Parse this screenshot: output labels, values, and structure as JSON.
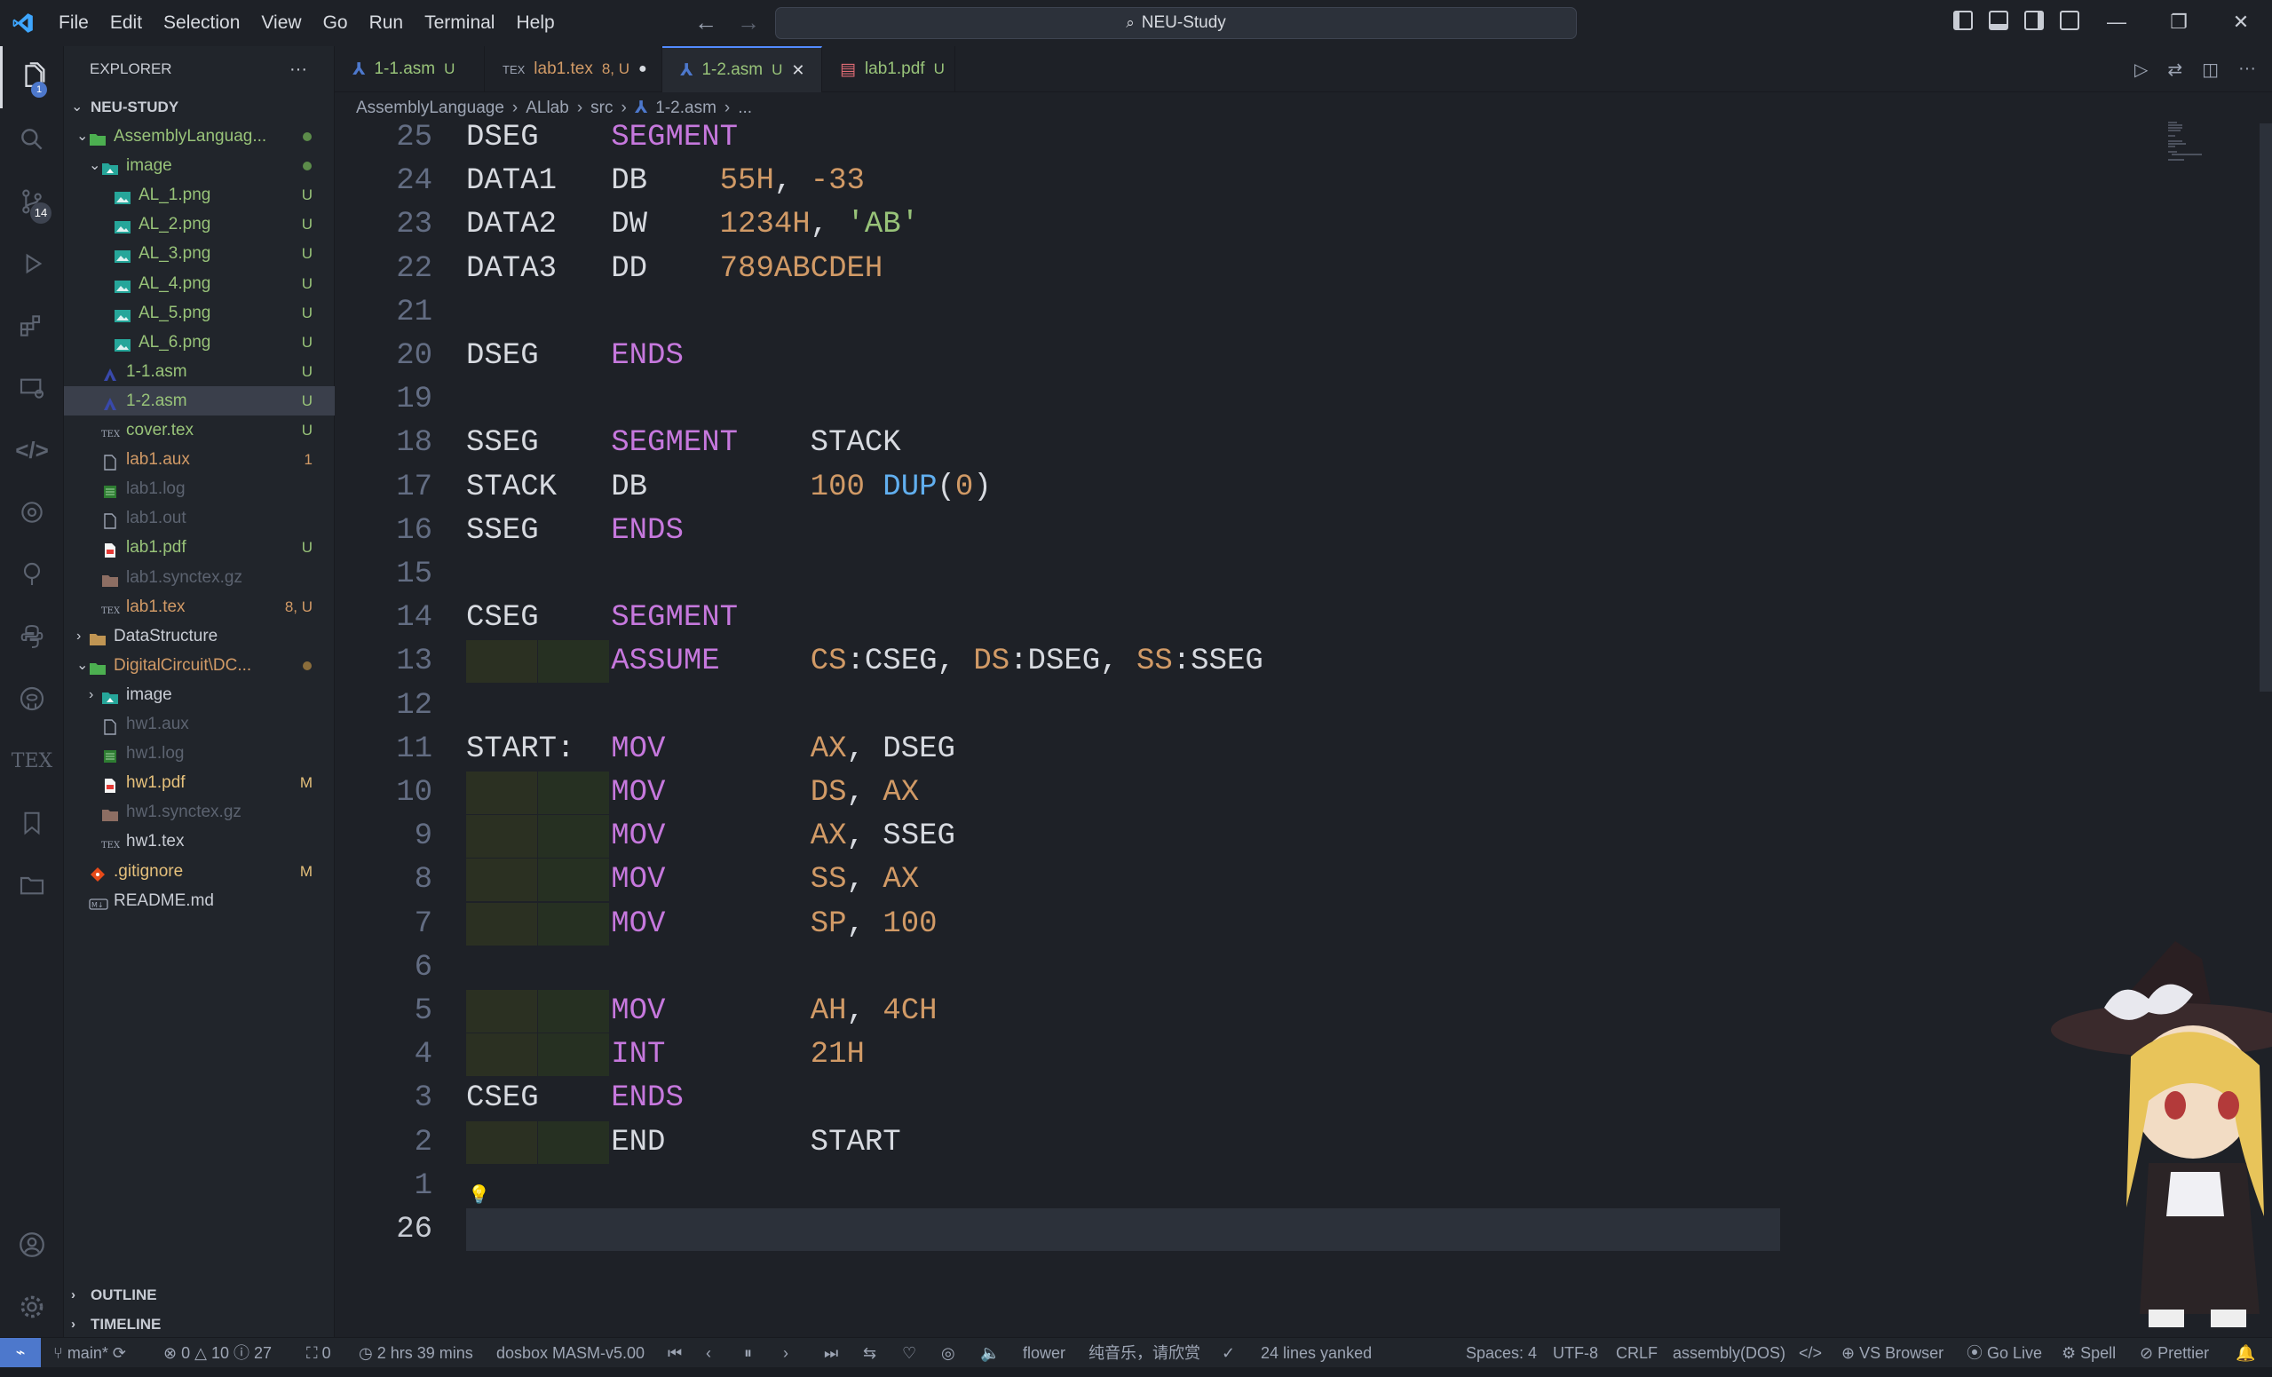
{
  "titlebar": {
    "menu": [
      "File",
      "Edit",
      "Selection",
      "View",
      "Go",
      "Run",
      "Terminal",
      "Help"
    ],
    "search_text": "NEU-Study"
  },
  "activity": {
    "explorer_badge": "1",
    "scm_badge": "14"
  },
  "sidebar": {
    "title": "EXPLORER",
    "more": "···",
    "root": "NEU-STUDY",
    "items": [
      {
        "label": "AssemblyLanguag...",
        "status": "",
        "color": "#98c379"
      },
      {
        "label": "image",
        "status": "",
        "color": "#98c379"
      },
      {
        "label": "AL_1.png",
        "status": "U",
        "color": "#98c379"
      },
      {
        "label": "AL_2.png",
        "status": "U",
        "color": "#98c379"
      },
      {
        "label": "AL_3.png",
        "status": "U",
        "color": "#98c379"
      },
      {
        "label": "AL_4.png",
        "status": "U",
        "color": "#98c379"
      },
      {
        "label": "AL_5.png",
        "status": "U",
        "color": "#98c379"
      },
      {
        "label": "AL_6.png",
        "status": "U",
        "color": "#98c379"
      },
      {
        "label": "1-1.asm",
        "status": "U",
        "color": "#98c379"
      },
      {
        "label": "1-2.asm",
        "status": "U",
        "color": "#98c379"
      },
      {
        "label": "cover.tex",
        "status": "U",
        "color": "#98c379"
      },
      {
        "label": "lab1.aux",
        "status": "1",
        "color": "#d19a66"
      },
      {
        "label": "lab1.log",
        "status": "",
        "color": "#5c6370"
      },
      {
        "label": "lab1.out",
        "status": "",
        "color": "#5c6370"
      },
      {
        "label": "lab1.pdf",
        "status": "U",
        "color": "#98c379"
      },
      {
        "label": "lab1.synctex.gz",
        "status": "",
        "color": "#5c6370"
      },
      {
        "label": "lab1.tex",
        "status": "8, U",
        "color": "#d19a66"
      },
      {
        "label": "DataStructure",
        "status": "",
        "color": "#c8ccd4"
      },
      {
        "label": "DigitalCircuit\\DC...",
        "status": "",
        "color": "#d19a66"
      },
      {
        "label": "image",
        "status": "",
        "color": "#c8ccd4"
      },
      {
        "label": "hw1.aux",
        "status": "",
        "color": "#5c6370"
      },
      {
        "label": "hw1.log",
        "status": "",
        "color": "#5c6370"
      },
      {
        "label": "hw1.pdf",
        "status": "M",
        "color": "#e5c07b"
      },
      {
        "label": "hw1.synctex.gz",
        "status": "",
        "color": "#5c6370"
      },
      {
        "label": "hw1.tex",
        "status": "",
        "color": "#c8ccd4"
      },
      {
        "label": ".gitignore",
        "status": "M",
        "color": "#e5c07b"
      },
      {
        "label": "README.md",
        "status": "",
        "color": "#c8ccd4"
      }
    ],
    "outline": "OUTLINE",
    "timeline": "TIMELINE"
  },
  "tabs": [
    {
      "label": "1-1.asm",
      "status": "U",
      "color": "#98c379"
    },
    {
      "label": "lab1.tex",
      "status": "8, U",
      "color": "#d19a66"
    },
    {
      "label": "1-2.asm",
      "status": "U",
      "color": "#98c379"
    },
    {
      "label": "lab1.pdf",
      "status": "U",
      "color": "#98c379"
    }
  ],
  "breadcrumb": [
    "AssemblyLanguage",
    "ALlab",
    "src",
    "1-2.asm",
    "..."
  ],
  "editor": {
    "lines": [
      {
        "num": "25",
        "t": [
          [
            "DSEG    ",
            "txt"
          ],
          [
            "SEGMENT",
            "kw"
          ]
        ]
      },
      {
        "num": "24",
        "t": [
          [
            "DATA1   ",
            "txt"
          ],
          [
            "DB    ",
            "txt"
          ],
          [
            "55H",
            "num"
          ],
          [
            ", ",
            "txt"
          ],
          [
            "-33",
            "num"
          ]
        ]
      },
      {
        "num": "23",
        "t": [
          [
            "DATA2   ",
            "txt"
          ],
          [
            "DW    ",
            "txt"
          ],
          [
            "1234H",
            "num"
          ],
          [
            ", ",
            "txt"
          ],
          [
            "'AB'",
            "str"
          ]
        ]
      },
      {
        "num": "22",
        "t": [
          [
            "DATA3   ",
            "txt"
          ],
          [
            "DD    ",
            "txt"
          ],
          [
            "789ABCDEH",
            "num"
          ]
        ]
      },
      {
        "num": "21",
        "t": []
      },
      {
        "num": "20",
        "t": [
          [
            "DSEG    ",
            "txt"
          ],
          [
            "ENDS",
            "kw"
          ]
        ]
      },
      {
        "num": "19",
        "t": []
      },
      {
        "num": "18",
        "t": [
          [
            "SSEG    ",
            "txt"
          ],
          [
            "SEGMENT",
            "kw"
          ],
          [
            "    STACK",
            "txt"
          ]
        ]
      },
      {
        "num": "17",
        "t": [
          [
            "STACK   ",
            "txt"
          ],
          [
            "DB         ",
            "txt"
          ],
          [
            "100 ",
            "num"
          ],
          [
            "DUP",
            "fn"
          ],
          [
            "(",
            "txt"
          ],
          [
            "0",
            "num"
          ],
          [
            ")",
            "txt"
          ]
        ]
      },
      {
        "num": "16",
        "t": [
          [
            "SSEG    ",
            "txt"
          ],
          [
            "ENDS",
            "kw"
          ]
        ]
      },
      {
        "num": "15",
        "t": []
      },
      {
        "num": "14",
        "t": [
          [
            "CSEG    ",
            "txt"
          ],
          [
            "SEGMENT",
            "kw"
          ]
        ]
      },
      {
        "num": "13",
        "t": [
          [
            "        ",
            "txt"
          ],
          [
            "ASSUME",
            "kw"
          ],
          [
            "     ",
            "txt"
          ],
          [
            "CS",
            "num"
          ],
          [
            ":CSEG, ",
            "txt"
          ],
          [
            "DS",
            "num"
          ],
          [
            ":DSEG, ",
            "txt"
          ],
          [
            "SS",
            "num"
          ],
          [
            ":SSEG",
            "txt"
          ]
        ]
      },
      {
        "num": "12",
        "t": []
      },
      {
        "num": "11",
        "t": [
          [
            "START:  ",
            "txt"
          ],
          [
            "MOV",
            "kw"
          ],
          [
            "        ",
            "txt"
          ],
          [
            "AX",
            "num"
          ],
          [
            ", DSEG",
            "txt"
          ]
        ]
      },
      {
        "num": "10",
        "t": [
          [
            "        ",
            "txt"
          ],
          [
            "MOV",
            "kw"
          ],
          [
            "        ",
            "txt"
          ],
          [
            "DS",
            "num"
          ],
          [
            ", ",
            "txt"
          ],
          [
            "AX",
            "num"
          ]
        ]
      },
      {
        "num": "9",
        "t": [
          [
            "        ",
            "txt"
          ],
          [
            "MOV",
            "kw"
          ],
          [
            "        ",
            "txt"
          ],
          [
            "AX",
            "num"
          ],
          [
            ", SSEG",
            "txt"
          ]
        ]
      },
      {
        "num": "8",
        "t": [
          [
            "        ",
            "txt"
          ],
          [
            "MOV",
            "kw"
          ],
          [
            "        ",
            "txt"
          ],
          [
            "SS",
            "num"
          ],
          [
            ", ",
            "txt"
          ],
          [
            "AX",
            "num"
          ]
        ]
      },
      {
        "num": "7",
        "t": [
          [
            "        ",
            "txt"
          ],
          [
            "MOV",
            "kw"
          ],
          [
            "        ",
            "txt"
          ],
          [
            "SP",
            "num"
          ],
          [
            ", ",
            "txt"
          ],
          [
            "100",
            "num"
          ]
        ]
      },
      {
        "num": "6",
        "t": []
      },
      {
        "num": "5",
        "t": [
          [
            "        ",
            "txt"
          ],
          [
            "MOV",
            "kw"
          ],
          [
            "        ",
            "txt"
          ],
          [
            "AH",
            "num"
          ],
          [
            ", ",
            "txt"
          ],
          [
            "4CH",
            "num"
          ]
        ]
      },
      {
        "num": "4",
        "t": [
          [
            "        ",
            "txt"
          ],
          [
            "INT",
            "kw"
          ],
          [
            "        ",
            "txt"
          ],
          [
            "21H",
            "num"
          ]
        ]
      },
      {
        "num": "3",
        "t": [
          [
            "CSEG    ",
            "txt"
          ],
          [
            "ENDS",
            "kw"
          ]
        ]
      },
      {
        "num": "2",
        "t": [
          [
            "        ",
            "txt"
          ],
          [
            "END",
            "txt"
          ],
          [
            "        START",
            "txt"
          ]
        ]
      },
      {
        "num": "1",
        "t": []
      },
      {
        "num": "26",
        "t": []
      }
    ],
    "current_line_index": 25
  },
  "statusbar": {
    "branch": "main*",
    "errors": "0",
    "warnings": "10",
    "infos": "27",
    "ports": "0",
    "time": "2 hrs 39 mins",
    "dosbox": "dosbox MASM-v5.00",
    "song": "flower",
    "artist": "纯音乐，请欣赏",
    "yank": "24 lines yanked",
    "spaces": "Spaces: 4",
    "encoding": "UTF-8",
    "eol": "CRLF",
    "language": "assembly(DOS)",
    "browser": "VS Browser",
    "golive": "Go Live",
    "spell": "Spell",
    "prettier": "Prettier"
  },
  "colors": {
    "accent": "#528bff",
    "untracked": "#98c379",
    "modified": "#e5c07b",
    "warning": "#d19a66"
  }
}
